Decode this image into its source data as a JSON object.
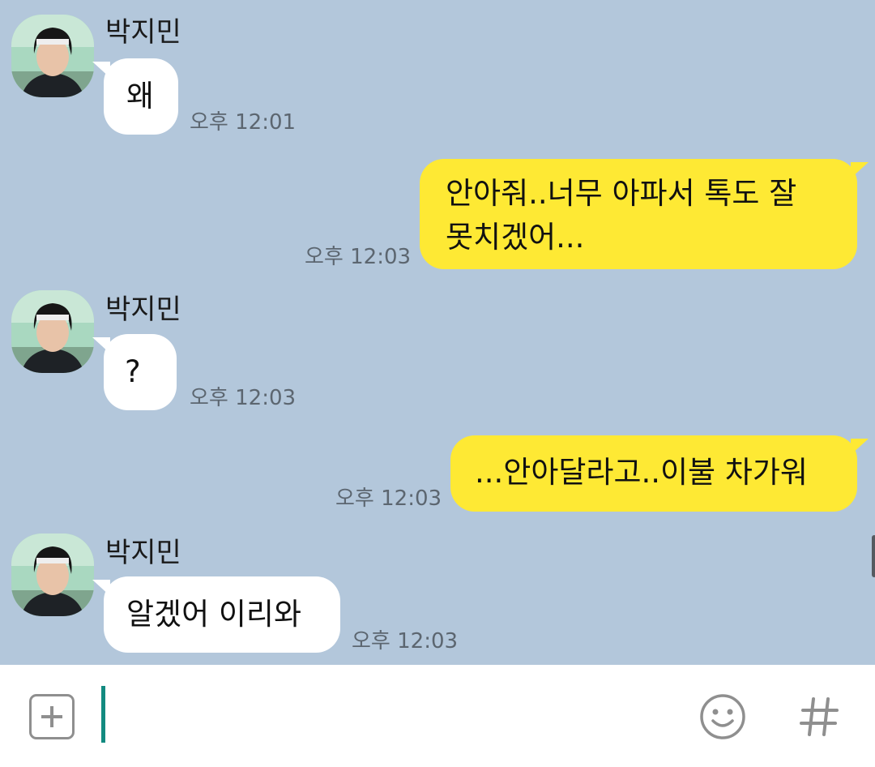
{
  "chat": {
    "contact_name": "박지민",
    "messages": [
      {
        "direction": "in",
        "text": "왜",
        "time": "오후 12:01"
      },
      {
        "direction": "out",
        "lines": [
          "안아줘..너무 아파서 톡도 잘",
          "못치겠어..."
        ],
        "time": "오후 12:03"
      },
      {
        "direction": "in",
        "text": "?",
        "time": "오후 12:03"
      },
      {
        "direction": "out",
        "text": "...안아달라고..이불 차가워",
        "time": "오후 12:03"
      },
      {
        "direction": "in",
        "text": "알겠어 이리와",
        "time": "오후 12:03"
      }
    ]
  },
  "input_bar": {
    "value": "",
    "icons": {
      "attach": "plus-square-icon",
      "emoji": "smiley-icon",
      "hashtag": "hash-icon"
    }
  },
  "colors": {
    "background": "#b3c7db",
    "incoming_bubble": "#ffffff",
    "outgoing_bubble": "#fee934",
    "cursor": "#128a80",
    "icon_gray": "#8f8f8f"
  }
}
